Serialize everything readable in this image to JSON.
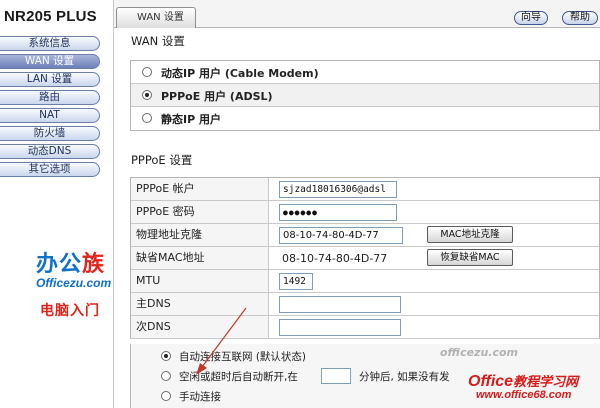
{
  "sidebar": {
    "brand": "NR205 PLUS",
    "items": [
      {
        "label": "系统信息",
        "active": false
      },
      {
        "label": "WAN 设置",
        "active": true
      },
      {
        "label": "LAN 设置",
        "active": false
      },
      {
        "label": "路由",
        "active": false
      },
      {
        "label": "NAT",
        "active": false
      },
      {
        "label": "防火墙",
        "active": false
      },
      {
        "label": "动态DNS",
        "active": false
      },
      {
        "label": "其它选项",
        "active": false
      }
    ],
    "logo": {
      "text_blue": "办公",
      "text_red": "族",
      "url": "Officezu.com",
      "subtitle": "电脑入门"
    }
  },
  "header": {
    "tab_label": "WAN 设置",
    "guide_button": "向导",
    "help_button": "帮助"
  },
  "wan": {
    "title": "WAN 设置",
    "options": [
      {
        "label": "动态IP 用户 (Cable Modem)",
        "selected": false
      },
      {
        "label": "PPPoE 用户 (ADSL)",
        "selected": true
      },
      {
        "label": "静态IP 用户",
        "selected": false
      }
    ]
  },
  "pppoe": {
    "title": "PPPoE 设置",
    "account_label": "PPPoE 帐户",
    "account_value": "sjzad18016306@adsl",
    "password_label": "PPPoE 密码",
    "password_value": "●●●●●●",
    "clone_label": "物理地址克隆",
    "clone_value": "08-10-74-80-4D-77",
    "clone_button": "MAC地址克隆",
    "default_mac_label": "缺省MAC地址",
    "default_mac_value": "08-10-74-80-4D-77",
    "restore_button": "恢复缺省MAC",
    "mtu_label": "MTU",
    "mtu_value": "1492",
    "dns1_label": "主DNS",
    "dns1_value": "",
    "dns2_label": "次DNS",
    "dns2_value": ""
  },
  "connect": {
    "options": [
      {
        "label": "自动连接互联网 (默认状态)",
        "selected": true
      },
      {
        "label_before": "空闲或超时后自动断开,在",
        "label_after": "分钟后, 如果没有发",
        "selected": false
      },
      {
        "label": "手动连接",
        "selected": false
      }
    ]
  },
  "watermark": {
    "center": "officezu.com",
    "title_en": "Office",
    "title_cn": "教程学习网",
    "url": "www.office68.com"
  },
  "colors": {
    "menu_border": "#6b7ea6",
    "menu_active": "#6c7fb8",
    "logo_blue": "#0d70c9",
    "logo_red": "#e1231b",
    "arrow": "#c0392b"
  }
}
